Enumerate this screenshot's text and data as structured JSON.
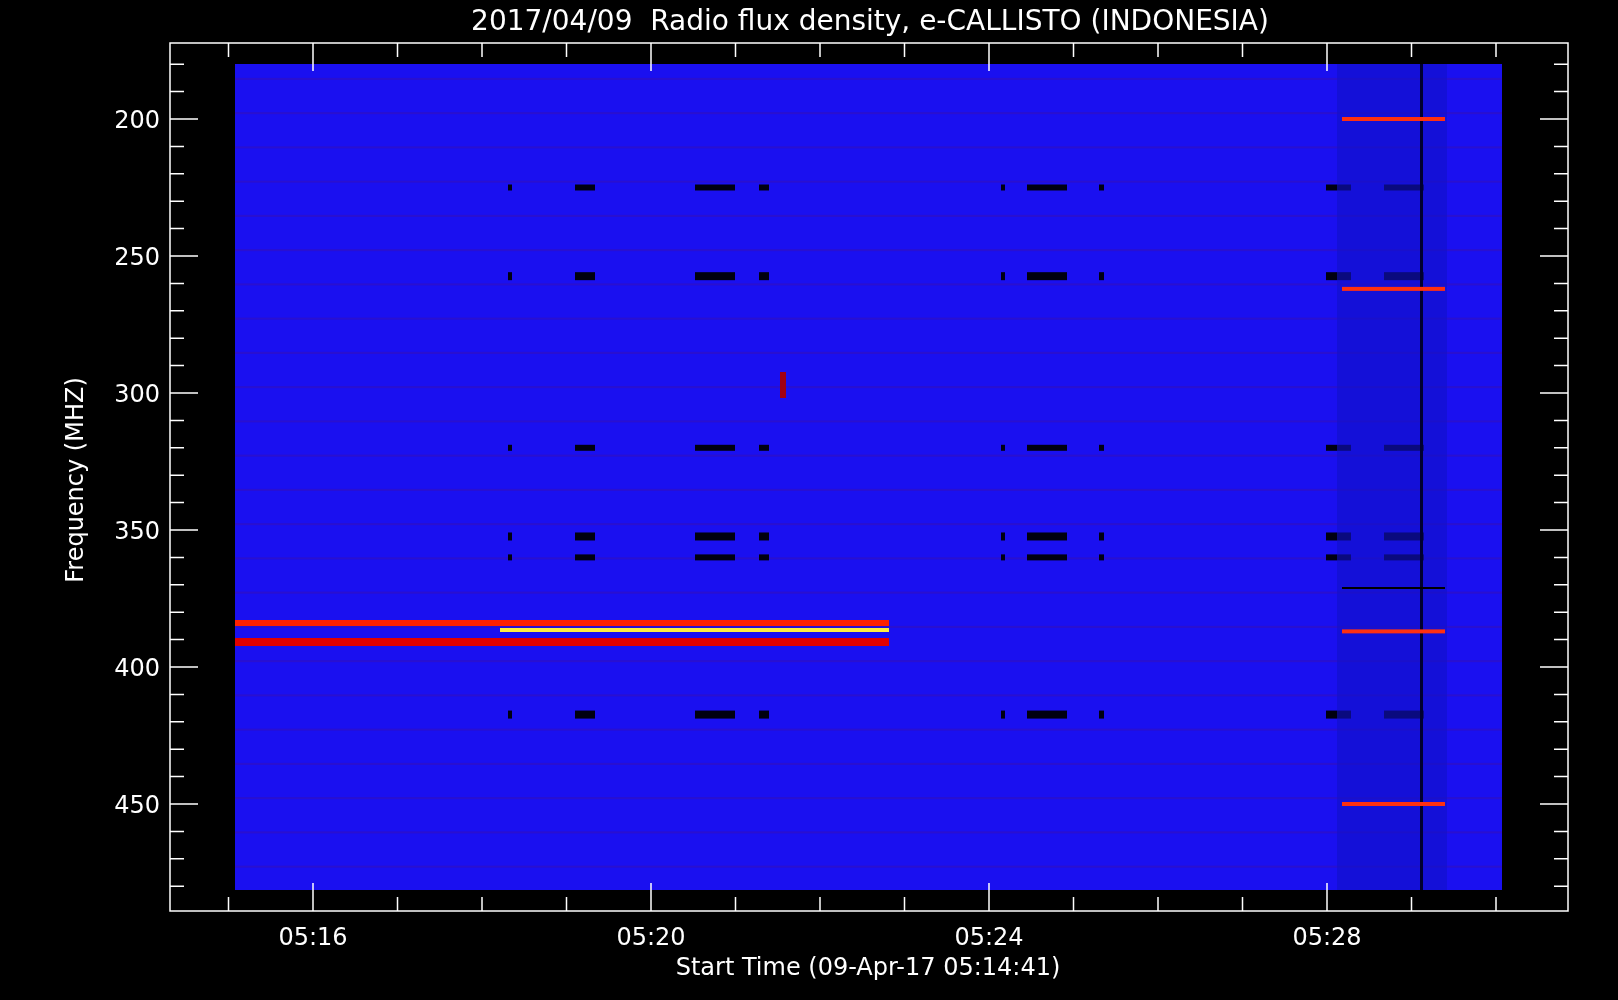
{
  "title": "2017/04/09  Radio flux density, e-CALLISTO (INDONESIA)",
  "y_axis": {
    "label": "Frequency (MHZ)",
    "tick_labels": [
      "200",
      "250",
      "300",
      "350",
      "400",
      "450"
    ]
  },
  "x_axis": {
    "label": "Start Time (09-Apr-17 05:14:41)",
    "tick_labels": [
      "05:16",
      "05:20",
      "05:24",
      "05:28"
    ]
  }
}
